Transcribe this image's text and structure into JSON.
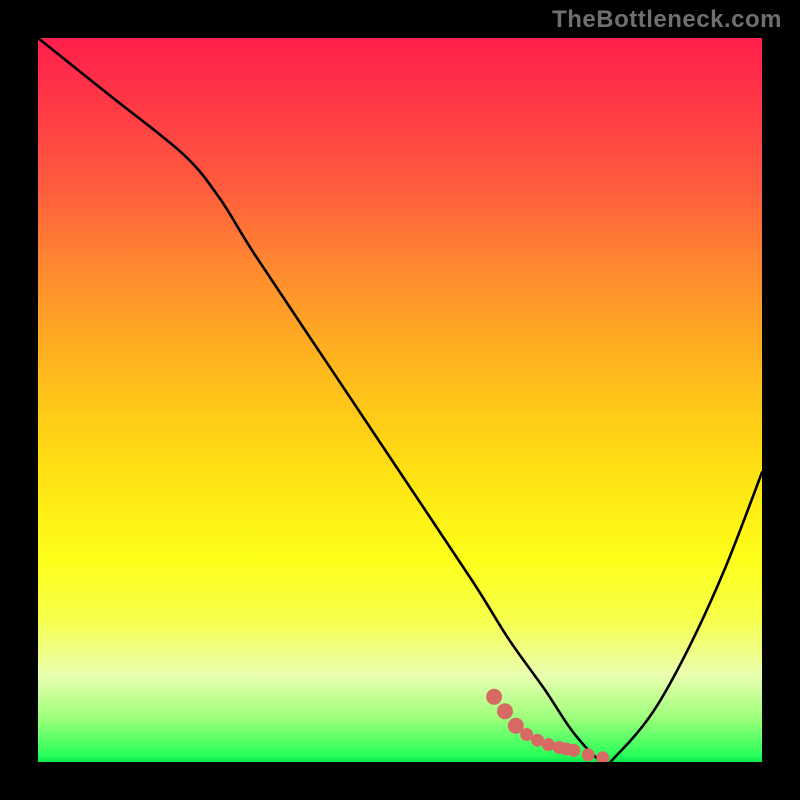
{
  "watermark": "TheBottleneck.com",
  "colors": {
    "frame": "#000000",
    "curve_stroke": "#000000",
    "marker_fill": "#d76b64",
    "gradient_top": "#ff1f4b",
    "gradient_mid": "#ffe112",
    "gradient_bottom": "#06e84a"
  },
  "chart_data": {
    "type": "line",
    "title": "",
    "xlabel": "",
    "ylabel": "",
    "xlim": [
      0,
      100
    ],
    "ylim": [
      0,
      100
    ],
    "x": [
      0,
      10,
      20,
      25,
      30,
      40,
      50,
      60,
      65,
      70,
      74,
      78,
      80,
      85,
      90,
      95,
      100
    ],
    "values": [
      100,
      92,
      84,
      78,
      70,
      55,
      40,
      25,
      17,
      10,
      4,
      0,
      1,
      7,
      16,
      27,
      40
    ],
    "series": [
      {
        "name": "bottleneck-curve",
        "x": [
          0,
          10,
          20,
          25,
          30,
          40,
          50,
          60,
          65,
          70,
          74,
          78,
          80,
          85,
          90,
          95,
          100
        ],
        "values": [
          100,
          92,
          84,
          78,
          70,
          55,
          40,
          25,
          17,
          10,
          4,
          0,
          1,
          7,
          16,
          27,
          40
        ]
      }
    ],
    "markers": {
      "name": "highlight-dots",
      "x": [
        63,
        64.5,
        66,
        67.5,
        69,
        70.5,
        72,
        73,
        74,
        76,
        78
      ],
      "values": [
        9,
        7,
        5,
        3.8,
        3,
        2.4,
        2,
        1.8,
        1.6,
        1.0,
        0.6
      ]
    },
    "minimum": {
      "x": 78,
      "value": 0
    }
  }
}
